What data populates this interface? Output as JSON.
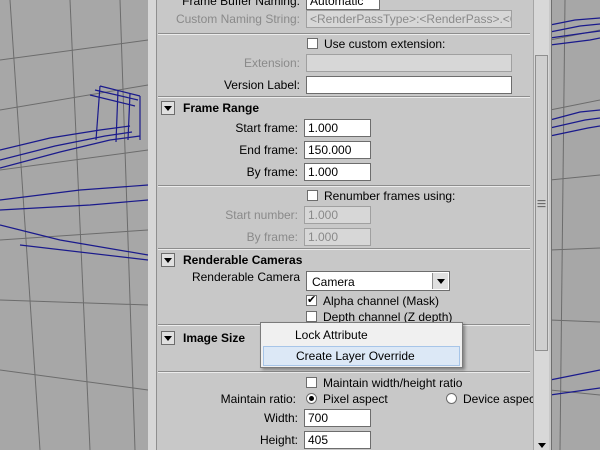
{
  "top_partial": {
    "frame_buffer_naming_label": "Frame Buffer Naming:",
    "frame_buffer_naming_value": "Automatic",
    "custom_naming_label": "Custom Naming String:",
    "custom_naming_value": "<RenderPassType>:<RenderPass>.<Came"
  },
  "extension_block": {
    "use_custom_extension_label": "Use custom extension:",
    "extension_label": "Extension:",
    "extension_value": "",
    "version_label_label": "Version Label:",
    "version_label_value": ""
  },
  "frame_range": {
    "title": "Frame Range",
    "start_frame_label": "Start frame:",
    "start_frame_value": "1.000",
    "end_frame_label": "End frame:",
    "end_frame_value": "150.000",
    "by_frame_label": "By frame:",
    "by_frame_value": "1.000",
    "renumber_label": "Renumber frames using:",
    "start_number_label": "Start number:",
    "start_number_value": "1.000",
    "renumber_by_frame_label": "By frame:",
    "renumber_by_frame_value": "1.000"
  },
  "renderable_cameras": {
    "title": "Renderable Cameras",
    "renderable_camera_label": "Renderable Camera",
    "renderable_camera_value": "Camera",
    "alpha_channel_label": "Alpha channel (Mask)",
    "depth_channel_label": "Depth channel (Z depth)"
  },
  "image_size": {
    "title": "Image Size",
    "maintain_wh_label": "Maintain width/height ratio",
    "maintain_ratio_label": "Maintain ratio:",
    "pixel_aspect_label": "Pixel aspect",
    "device_aspect_label": "Device aspect",
    "width_label": "Width:",
    "width_value": "700",
    "height_label": "Height:",
    "height_value": "405"
  },
  "context_menu": {
    "items": [
      {
        "label": "Lock Attribute"
      },
      {
        "label": "Create Layer Override"
      }
    ]
  },
  "colors": {
    "panel_bg": "#c8c8c8",
    "viewport_bg": "#a7a7a7",
    "wireframe": "#1a1a8c",
    "menu_highlight": "#dce8f6"
  }
}
